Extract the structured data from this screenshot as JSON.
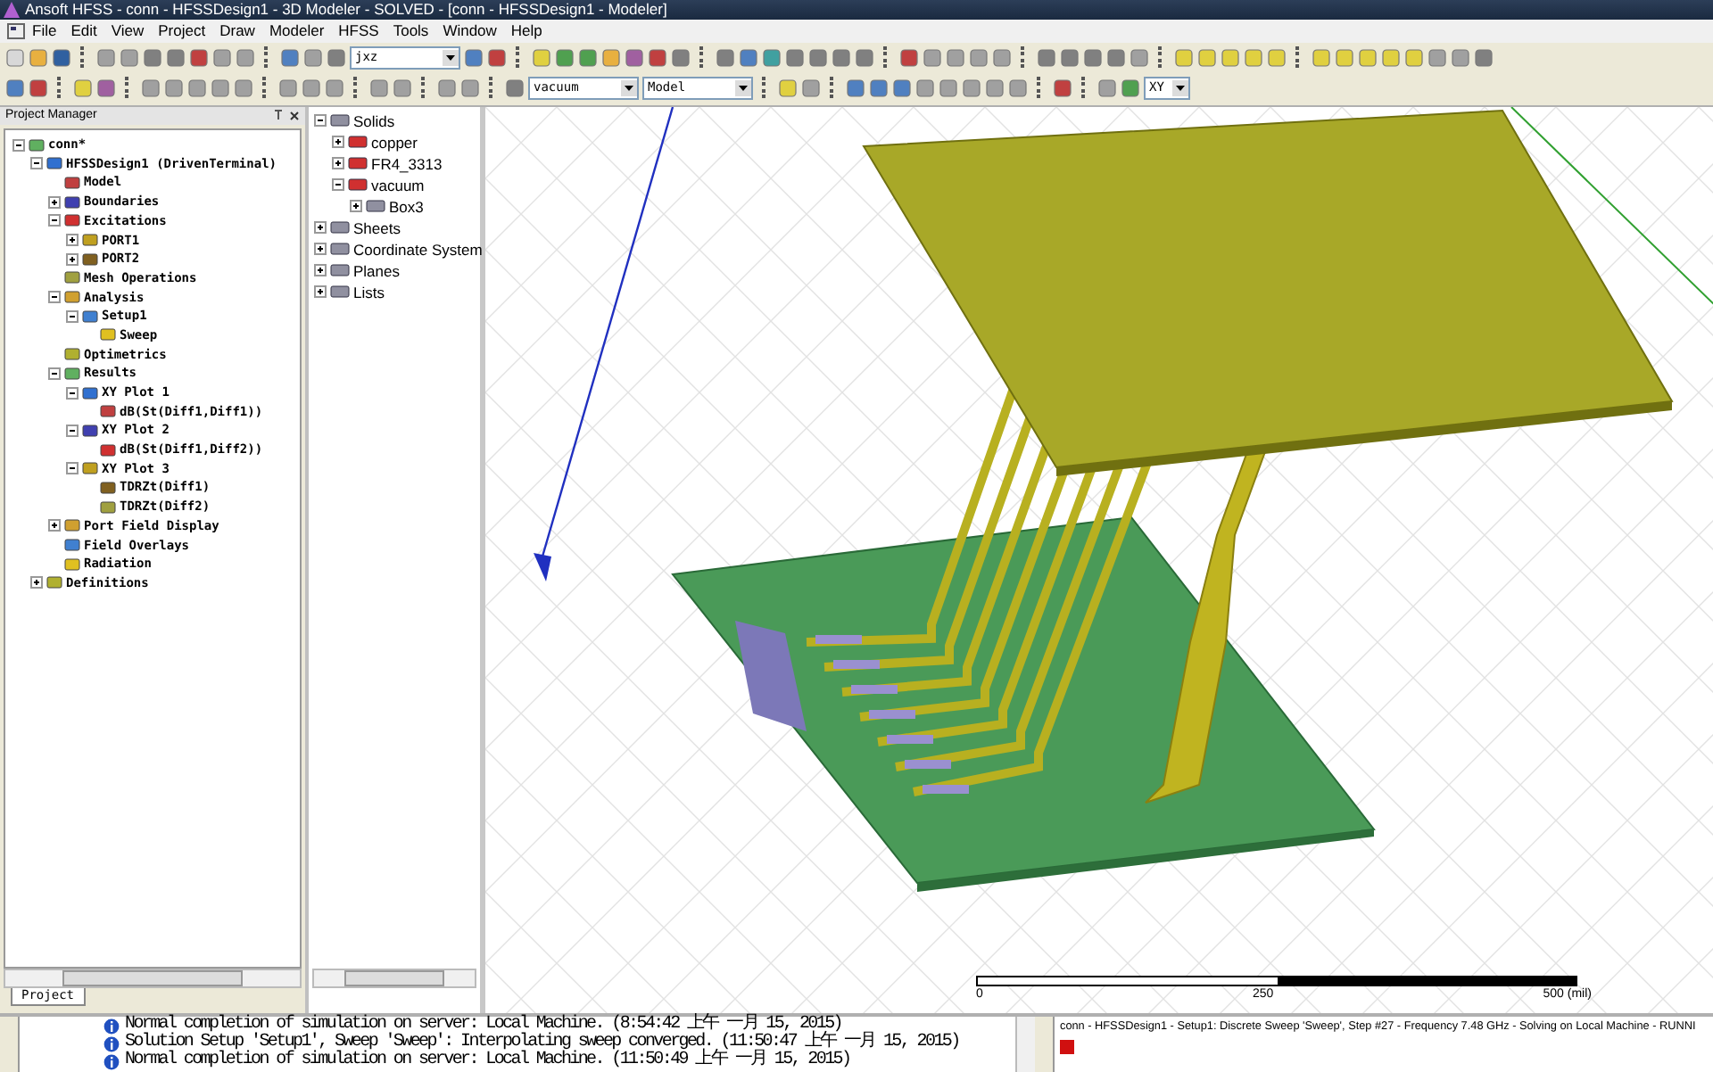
{
  "window": {
    "title": "Ansoft HFSS - conn - HFSSDesign1 - 3D Modeler - SOLVED - [conn - HFSSDesign1 - Modeler]"
  },
  "menu": [
    "File",
    "Edit",
    "View",
    "Project",
    "Draw",
    "Modeler",
    "HFSS",
    "Tools",
    "Window",
    "Help"
  ],
  "toolbar": {
    "combos": [
      {
        "value": "jxz"
      },
      {
        "value": "vacuum"
      },
      {
        "value": "Model"
      },
      {
        "value": "XY"
      }
    ]
  },
  "project_manager": {
    "title": "Project Manager",
    "tab": "Project",
    "tree": [
      {
        "label": "conn*",
        "expanded": true,
        "children": [
          {
            "label": "HFSSDesign1 (DrivenTerminal)",
            "expanded": true,
            "children": [
              {
                "label": "Model"
              },
              {
                "label": "Boundaries",
                "expanded": false
              },
              {
                "label": "Excitations",
                "expanded": true,
                "children": [
                  {
                    "label": "PORT1",
                    "expanded": false
                  },
                  {
                    "label": "PORT2",
                    "expanded": false
                  }
                ]
              },
              {
                "label": "Mesh Operations"
              },
              {
                "label": "Analysis",
                "expanded": true,
                "children": [
                  {
                    "label": "Setup1",
                    "expanded": true,
                    "children": [
                      {
                        "label": "Sweep"
                      }
                    ]
                  }
                ]
              },
              {
                "label": "Optimetrics"
              },
              {
                "label": "Results",
                "expanded": true,
                "children": [
                  {
                    "label": "XY Plot 1",
                    "expanded": true,
                    "children": [
                      {
                        "label": "dB(St(Diff1,Diff1))"
                      }
                    ]
                  },
                  {
                    "label": "XY Plot 2",
                    "expanded": true,
                    "children": [
                      {
                        "label": "dB(St(Diff1,Diff2))"
                      }
                    ]
                  },
                  {
                    "label": "XY Plot 3",
                    "expanded": true,
                    "children": [
                      {
                        "label": "TDRZt(Diff1)"
                      },
                      {
                        "label": "TDRZt(Diff2)"
                      }
                    ]
                  }
                ]
              },
              {
                "label": "Port Field Display",
                "expanded": false
              },
              {
                "label": "Field Overlays"
              },
              {
                "label": "Radiation"
              }
            ]
          },
          {
            "label": "Definitions",
            "expanded": false
          }
        ]
      }
    ]
  },
  "model_tree": [
    {
      "label": "Solids",
      "expanded": true,
      "children": [
        {
          "label": "copper",
          "expanded": false
        },
        {
          "label": "FR4_3313",
          "expanded": false
        },
        {
          "label": "vacuum",
          "expanded": true,
          "children": [
            {
              "label": "Box3",
              "expanded": false
            }
          ]
        }
      ]
    },
    {
      "label": "Sheets",
      "expanded": false
    },
    {
      "label": "Coordinate System",
      "expanded": false
    },
    {
      "label": "Planes",
      "expanded": false
    },
    {
      "label": "Lists",
      "expanded": false
    }
  ],
  "view": {
    "scale": [
      "0",
      "250",
      "500 (mil)"
    ]
  },
  "messages": [
    "Normal completion of simulation on server: Local Machine. (8:54:42 上午  一月 15, 2015)",
    "Solution Setup 'Setup1', Sweep 'Sweep': Interpolating sweep converged. (11:50:47 上午  一月 15, 2015)",
    "Normal completion of simulation on server: Local Machine. (11:50:49 上午  一月 15, 2015)"
  ],
  "progress": {
    "text": "conn - HFSSDesign1 - Setup1: Discrete Sweep 'Sweep', Step #27 - Frequency 7.48 GHz - Solving on Local Machine - RUNNI"
  }
}
